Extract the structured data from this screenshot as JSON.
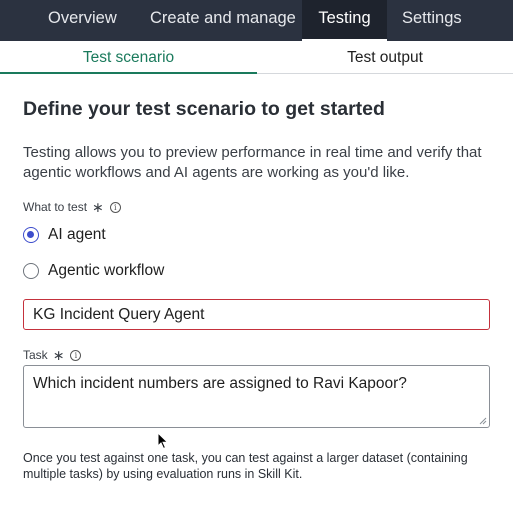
{
  "top_nav": {
    "items": [
      "Overview",
      "Create and manage",
      "Testing",
      "Settings"
    ],
    "active": "Testing"
  },
  "sub_tabs": {
    "items": [
      "Test scenario",
      "Test output"
    ],
    "active": "Test scenario",
    "active_color": "#1a7a5c"
  },
  "page": {
    "title": "Define your test scenario to get started",
    "description": "Testing allows you to preview performance in real time and verify that agentic workflows and AI agents are working as you'd like."
  },
  "what_to_test": {
    "label": "What to test",
    "required_mark": "∗",
    "info_icon": "i",
    "options": [
      "AI agent",
      "Agentic workflow"
    ],
    "selected": "AI agent",
    "agent_value": "KG Incident Query Agent",
    "error_border_color": "#c4313c"
  },
  "task": {
    "label": "Task",
    "required_mark": "∗",
    "info_icon": "i",
    "value": "Which incident numbers are assigned to Ravi Kapoor?"
  },
  "footnote": "Once you test against one task, you can test against a larger dataset (containing multiple tasks) by using evaluation runs in Skill Kit.",
  "colors": {
    "nav_bg": "#2b3240",
    "radio_accent": "#3d4dcc"
  }
}
